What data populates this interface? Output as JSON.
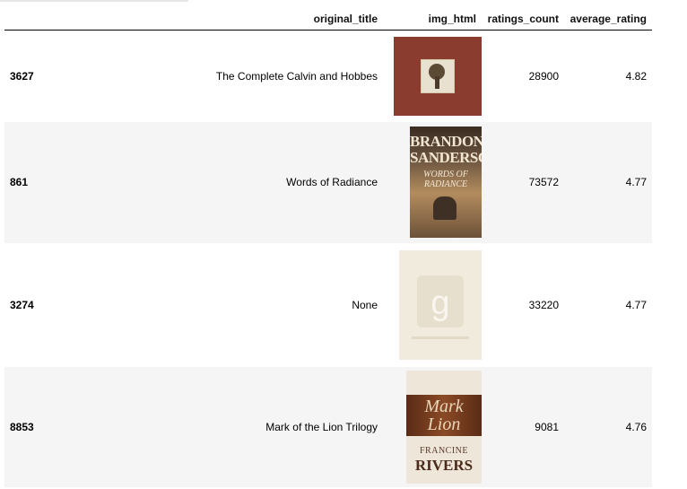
{
  "table": {
    "columns": {
      "index": "",
      "original_title": "original_title",
      "img_html": "img_html",
      "ratings_count": "ratings_count",
      "average_rating": "average_rating"
    },
    "rows": [
      {
        "index": "3627",
        "original_title": "The Complete Calvin and Hobbes",
        "cover": "calvin-and-hobbes-cover-image",
        "ratings_count": "28900",
        "average_rating": "4.82"
      },
      {
        "index": "861",
        "original_title": "Words of Radiance",
        "cover": "words-of-radiance-cover-image",
        "cover_author_line1": "BRANDON",
        "cover_author_line2": "SANDERSON",
        "cover_title": "WORDS OF RADIANCE",
        "ratings_count": "73572",
        "average_rating": "4.77"
      },
      {
        "index": "3274",
        "original_title": "None",
        "cover": "placeholder-g-cover-image",
        "cover_glyph": "g",
        "ratings_count": "33220",
        "average_rating": "4.77"
      },
      {
        "index": "8853",
        "original_title": "Mark of the Lion Trilogy",
        "cover": "mark-of-the-lion-cover-image",
        "cover_title_line1": "Mark",
        "cover_title_line2": "Lion",
        "cover_author_first": "FRANCINE",
        "cover_author_last": "RIVERS",
        "ratings_count": "9081",
        "average_rating": "4.76"
      }
    ]
  },
  "colors": {
    "header_border": "#000000",
    "stripe_row": "#f5f5f5"
  }
}
